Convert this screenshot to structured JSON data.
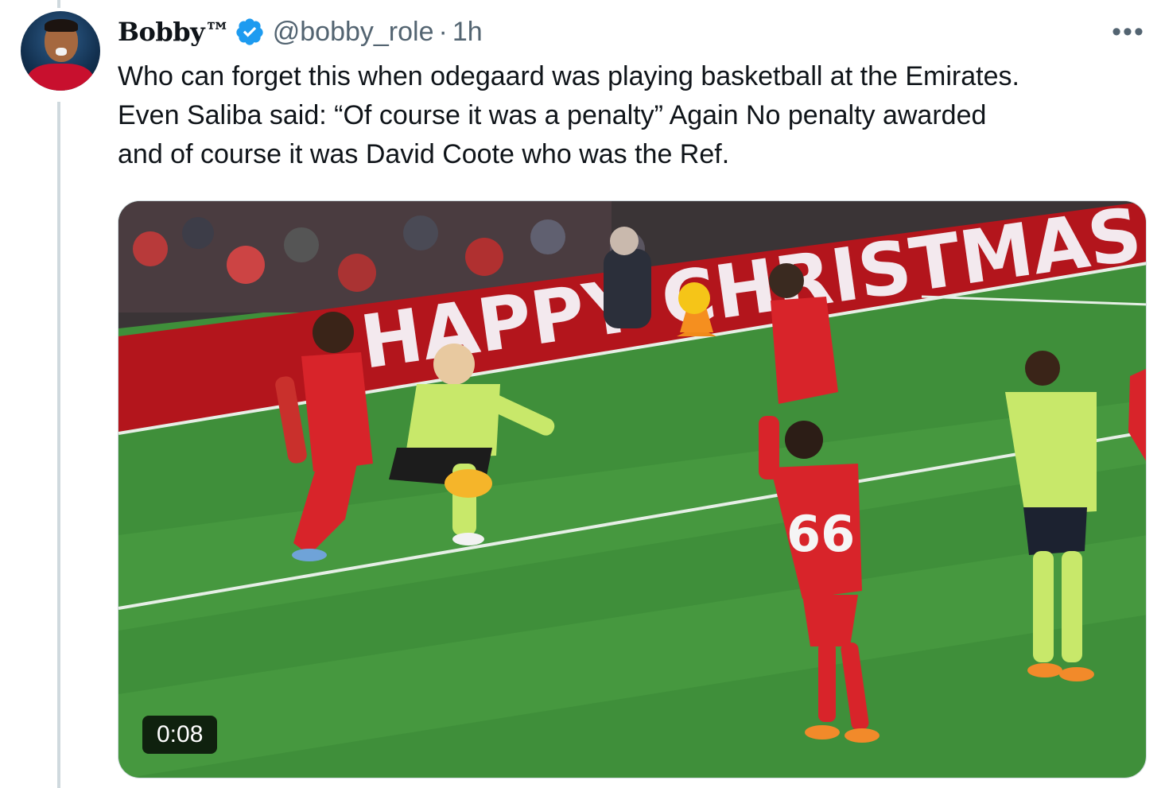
{
  "user": {
    "display_name": "Bobby™",
    "handle": "@bobby_role",
    "separator": "·",
    "time": "1h",
    "verified": true
  },
  "tweet": {
    "lines": [
      "Who can forget this when odegaard was playing basketball at the Emirates.",
      "Even Saliba said: “Of course it was a penalty” Again No penalty awarded",
      "and of course it was David Coote who was the Ref."
    ]
  },
  "media": {
    "duration": "0:08",
    "banner_text": "HAPPY CHRISTMAS",
    "player_number": "66"
  },
  "icons": {
    "more": "more-options-icon",
    "verified": "verified-badge-icon"
  },
  "colors": {
    "verified_blue": "#1d9bf0",
    "text": "#0f1419",
    "secondary": "#536471",
    "pitch": "#3f8f3a",
    "banner": "#b3151c",
    "home_kit": "#d8242a",
    "away_kit": "#c8e86a"
  }
}
